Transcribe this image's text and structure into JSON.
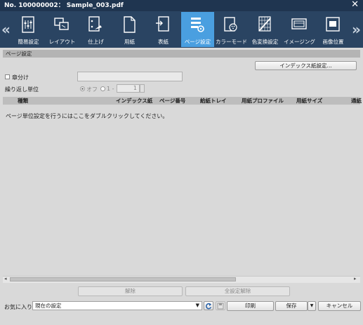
{
  "window": {
    "title": "No. 100000002： Sample_003.pdf",
    "close": "✕"
  },
  "toolbar": {
    "prev": "«",
    "next": "»",
    "items": [
      {
        "label": "簡易設定",
        "icon": "simple-settings-icon"
      },
      {
        "label": "レイアウト",
        "icon": "layout-icon"
      },
      {
        "label": "仕上げ",
        "icon": "finishing-icon"
      },
      {
        "label": "用紙",
        "icon": "paper-icon"
      },
      {
        "label": "表紙",
        "icon": "cover-icon"
      },
      {
        "label": "ページ設定",
        "icon": "page-settings-icon",
        "active": true
      },
      {
        "label": "カラーモード",
        "icon": "color-mode-icon"
      },
      {
        "label": "色変換設定",
        "icon": "color-conversion-icon"
      },
      {
        "label": "イメージング",
        "icon": "imaging-icon"
      },
      {
        "label": "画像位置",
        "icon": "image-position-icon"
      }
    ]
  },
  "page_settings": {
    "section_title": "ページ設定",
    "index_button": "インデックス紙設定...",
    "chapter_label": "章分け",
    "repeat_unit_label": "繰り返し単位",
    "off_label": "オフ",
    "one_label": "1 -",
    "spinner_value": "1",
    "columns": [
      "種類",
      "インデックス紙",
      "ページ番号",
      "給紙トレイ",
      "用紙プロファイル",
      "用紙サイズ",
      "通紙"
    ],
    "empty_hint": "ページ単位設定を行うにはここをダブルクリックしてください。",
    "remove_button": "解除",
    "remove_all_button": "全設定解除"
  },
  "footer": {
    "favorites_label": "お気に入り",
    "favorites_value": "現在の設定",
    "print_button": "印刷",
    "save_button": "保存",
    "cancel_button": "キャンセル"
  },
  "colors": {
    "titlebar": "#1f3550",
    "toolbar": "#2a4462",
    "active_tab": "#4a9fe0"
  }
}
